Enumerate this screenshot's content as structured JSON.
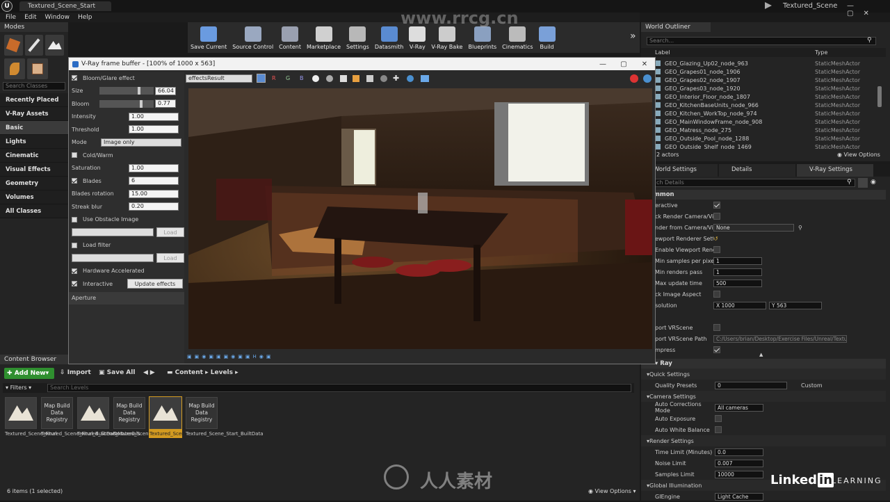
{
  "window": {
    "doc_tab": "Textured_Scene_Start",
    "project": "Textured_Scene"
  },
  "menu": [
    "File",
    "Edit",
    "Window",
    "Help"
  ],
  "modes": {
    "header": "Modes",
    "search_placeholder": "Search Classes",
    "items": [
      "Recently Placed",
      "V-Ray Assets",
      "Basic",
      "Lights",
      "Cinematic",
      "Visual Effects",
      "Geometry",
      "Volumes",
      "All Classes"
    ],
    "selected": "Basic"
  },
  "toolbar": [
    {
      "label": "Save Current",
      "icon": "save-icon"
    },
    {
      "label": "Source Control",
      "icon": "source-control-icon"
    },
    {
      "label": "Content",
      "icon": "content-icon"
    },
    {
      "label": "Marketplace",
      "icon": "marketplace-icon"
    },
    {
      "label": "Settings",
      "icon": "settings-icon"
    },
    {
      "label": "Datasmith",
      "icon": "datasmith-icon"
    },
    {
      "label": "V-Ray",
      "icon": "vray-icon"
    },
    {
      "label": "V-Ray Bake",
      "icon": "vray-bake-icon"
    },
    {
      "label": "Blueprints",
      "icon": "blueprints-icon"
    },
    {
      "label": "Cinematics",
      "icon": "cinematics-icon"
    },
    {
      "label": "Build",
      "icon": "build-icon"
    }
  ],
  "vfb": {
    "title": "V-Ray frame buffer - [100% of 1000 x 563]",
    "channel": "effectsResult",
    "toolbar_letters": [
      "R",
      "G",
      "B"
    ],
    "bloom": {
      "label": "Bloom/Glare effect",
      "size_label": "Size",
      "size": "66.04",
      "bloom_label": "Bloom",
      "bloom": "0.77",
      "intensity_label": "Intensity",
      "intensity": "1.00",
      "threshold_label": "Threshold",
      "threshold": "1.00",
      "mode_label": "Mode",
      "mode": "Image only",
      "coldwarm_label": "Cold/Warm",
      "saturation_label": "Saturation",
      "saturation": "1.00",
      "blades_label": "Blades",
      "blades": "6",
      "blades_rotation_label": "Blades rotation",
      "blades_rotation": "15.00",
      "streak_blur_label": "Streak blur",
      "streak_blur": "0.20",
      "obstacle_label": "Use Obstacle Image",
      "load_label": "Load",
      "load_filter_label": "Load filter",
      "hw_label": "Hardware Accelerated",
      "interactive_label": "Interactive",
      "update_label": "Update effects",
      "aperture_label": "Aperture"
    }
  },
  "outliner": {
    "header": "World Outliner",
    "search_placeholder": "Search...",
    "col_label": "Label",
    "col_type": "Type",
    "rows": [
      {
        "label": "GEO_Glazing_Up02_node_963",
        "type": "StaticMeshActor"
      },
      {
        "label": "GEO_Grapes01_node_1906",
        "type": "StaticMeshActor"
      },
      {
        "label": "GEO_Grapes02_node_1907",
        "type": "StaticMeshActor"
      },
      {
        "label": "GEO_Grapes03_node_1920",
        "type": "StaticMeshActor"
      },
      {
        "label": "GEO_Interior_Floor_node_1807",
        "type": "StaticMeshActor"
      },
      {
        "label": "GEO_KitchenBaseUnits_node_966",
        "type": "StaticMeshActor"
      },
      {
        "label": "GEO_Kitchen_WorkTop_node_974",
        "type": "StaticMeshActor"
      },
      {
        "label": "GEO_MainWindowFrame_node_908",
        "type": "StaticMeshActor"
      },
      {
        "label": "GEO_Matress_node_275",
        "type": "StaticMeshActor"
      },
      {
        "label": "GEO_Outside_Pool_node_1288",
        "type": "StaticMeshActor"
      },
      {
        "label": "GEO_Outside_Shelf_node_1469",
        "type": "StaticMeshActor"
      }
    ],
    "count": "2 actors",
    "view_options": "View Options"
  },
  "details": {
    "tabs": [
      "World Settings",
      "Details",
      "V-Ray Settings"
    ],
    "search_placeholder": "ch Details",
    "common_header": "mmon",
    "rows": [
      {
        "label": "eractive",
        "kind": "check",
        "value": true
      },
      {
        "label": "ck Render Camera/View",
        "kind": "check",
        "value": false
      },
      {
        "label": "nder from Camera/View",
        "kind": "select",
        "value": "None"
      },
      {
        "label": "ewport Renderer Settings",
        "kind": "reset",
        "value": ""
      },
      {
        "label": "Enable Viewport Rendering",
        "kind": "check",
        "value": false
      },
      {
        "label": "Min samples per pixel",
        "kind": "num",
        "value": "1"
      },
      {
        "label": "Min renders pass",
        "kind": "num",
        "value": "1"
      },
      {
        "label": "Max update time",
        "kind": "num",
        "value": "500"
      },
      {
        "label": "ck Image Aspect",
        "kind": "check",
        "value": false
      },
      {
        "label": "solution",
        "kind": "res",
        "value": "X 1000",
        "value2": "Y 563"
      },
      {
        "label": "",
        "kind": "blank",
        "value": ""
      },
      {
        "label": "port VRScene",
        "kind": "check",
        "value": false
      },
      {
        "label": "port VRScene Path",
        "kind": "path",
        "value": "C:/Users/brian/Desktop/Exercise Files/Unreal/Textured"
      },
      {
        "label": "mpress",
        "kind": "check",
        "value": true
      }
    ],
    "vray_header": "Ray",
    "sections": [
      {
        "title": "Quick Settings",
        "rows": [
          {
            "label": "Quality Presets",
            "value": "0",
            "extra": "Custom"
          }
        ]
      },
      {
        "title": "Camera Settings",
        "rows": [
          {
            "label": "Auto Corrections Mode",
            "value": "All cameras"
          },
          {
            "label": "Auto Exposure",
            "value": ""
          },
          {
            "label": "Auto White Balance",
            "value": ""
          }
        ]
      },
      {
        "title": "Render Settings",
        "rows": [
          {
            "label": "Time Limit (Minutes)",
            "value": "0.0"
          },
          {
            "label": "Noise Limit",
            "value": "0.007"
          },
          {
            "label": "Samples Limit",
            "value": "10000"
          }
        ]
      },
      {
        "title": "Global Illumination",
        "rows": [
          {
            "label": "GIEngine",
            "value": "Light Cache"
          }
        ]
      }
    ]
  },
  "content_browser": {
    "header": "Content Browser",
    "add_new": "Add New",
    "import": "Import",
    "save_all": "Save All",
    "breadcrumb": [
      "Content",
      "Levels"
    ],
    "filters": "Filters",
    "search_placeholder": "Search Levels",
    "assets": [
      {
        "kind": "level",
        "label": "Textured_Scene_Final",
        "selected": false
      },
      {
        "kind": "registry",
        "thumb": "Map Build Data Registry",
        "label": "Textured_Scene_Final_BuiltData",
        "selected": false
      },
      {
        "kind": "level",
        "label": "Textured_Scene_Materials",
        "selected": false
      },
      {
        "kind": "registry",
        "thumb": "Map Build Data Registry",
        "label": "Textured_Scene_Materials",
        "selected": false
      },
      {
        "kind": "level",
        "label": "Textured_Scene_Start",
        "selected": true
      },
      {
        "kind": "registry",
        "thumb": "Map Build Data Registry",
        "label": "Textured_Scene_Start_BuiltData",
        "selected": false
      }
    ],
    "status": "6 items (1 selected)",
    "view_options": "View Options"
  },
  "watermarks": {
    "site": "www.rrcg.cn",
    "brand": "Linked",
    "brand_in": "in",
    "learning": "LEARNING",
    "cn": "人人素材"
  }
}
